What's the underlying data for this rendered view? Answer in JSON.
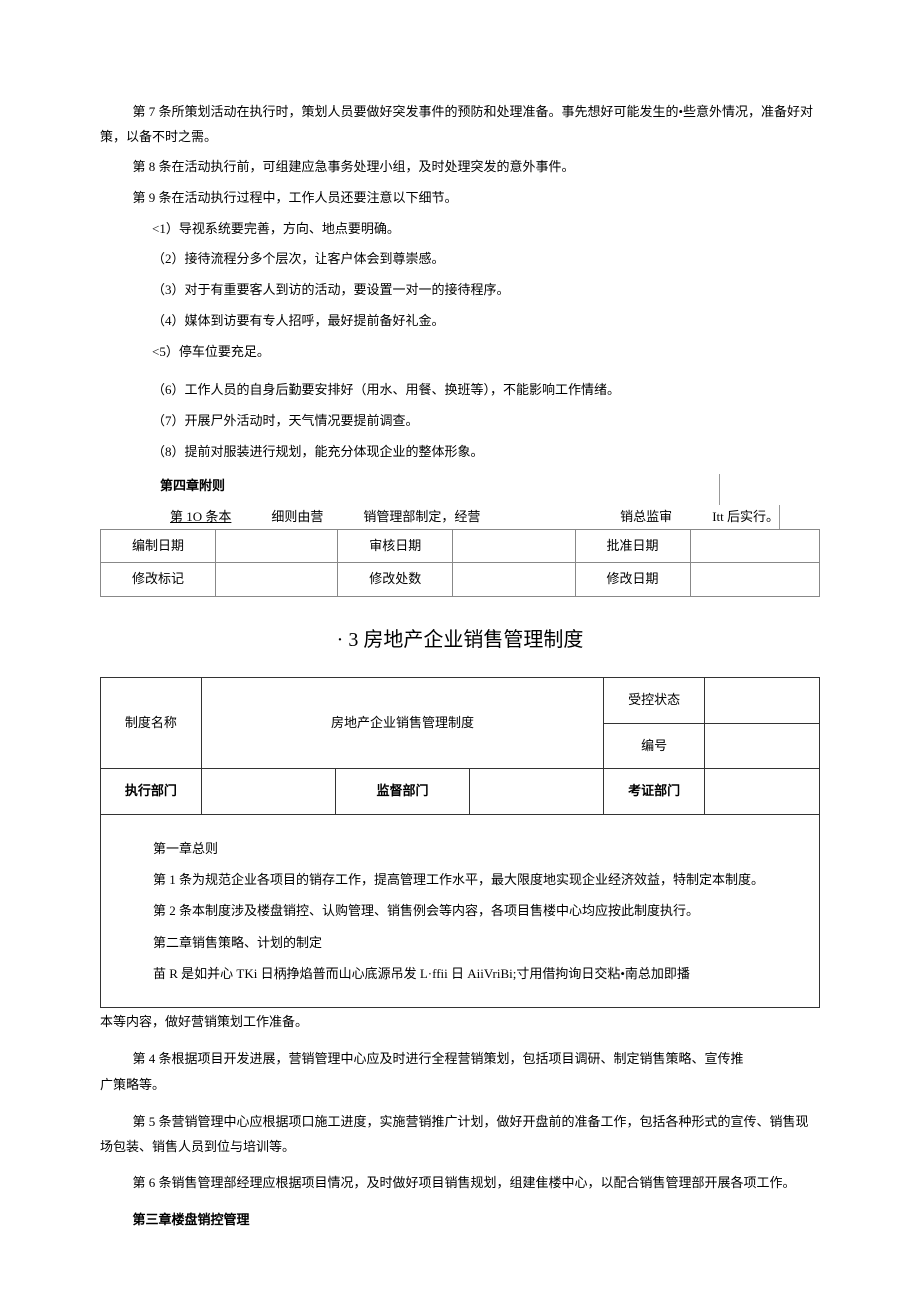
{
  "body": {
    "p7": "第 7 条所策划活动在执行时，策划人员要做好突发事件的预防和处理准备。事先想好可能发生的•些意外情况，准备好对策，以备不时之需。",
    "p8": "第 8 条在活动执行前，可组建应急事务处理小组，及时处理突发的意外事件。",
    "p9": "第 9 条在活动执行过程中，工作人员还要注意以下细节。",
    "s1": "<1）导视系统要完善，方向、地点要明确。",
    "s2": "（2）接待流程分多个层次，让客户体会到尊崇感。",
    "s3": "（3）对于有重要客人到访的活动，要设置一对一的接待程序。",
    "s4": "（4）媒体到访要有专人招呼，最好提前备好礼金。",
    "s5": "<5）停车位要充足。",
    "s6": "（6）工作人员的自身后勤要安排好（用水、用餐、换班等），不能影响工作情绪。",
    "s7": "（7）开展尸外活动时，天气情况要提前调查。",
    "s8": "（8）提前对服装进行规划，能充分体现企业的整体形象。",
    "chapter4": "第四章附则",
    "a10": {
      "a": "第 1O 条本",
      "b": "细则由营",
      "c": "销管理部制定，经营",
      "d": "销总监审",
      "e": "Itt 后实行。"
    }
  },
  "meta1": {
    "r1": {
      "c1": "编制日期",
      "c2": "",
      "c3": "审核日期",
      "c4": "",
      "c5": "批准日期",
      "c6": ""
    },
    "r2": {
      "c1": "修改标记",
      "c2": "",
      "c3": "修改处数",
      "c4": "",
      "c5": "修改日期",
      "c6": ""
    }
  },
  "section_title": "· 3 房地产企业销售管理制度",
  "dochead": {
    "name_label": "制度名称",
    "name_value": "房地产企业销售管理制度",
    "status_label": "受控状态",
    "status_value": "",
    "code_label": "编号",
    "code_value": "",
    "exec_label": "执行部门",
    "exec_value": "",
    "super_label": "监督部门",
    "super_value": "",
    "verify_label": "考证部门",
    "verify_value": ""
  },
  "box": {
    "ch1": "第一章总则",
    "p1": "第 1 条为规范企业各项目的销存工作，提高管理工作水平，最大限度地实现企业经济效益，特制定本制度。",
    "p2": "第 2 条本制度涉及楼盘销控、认购管理、销售例会等内容，各项目售楼中心均应按此制度执行。",
    "ch2": "第二章销售策略、计划的制定",
    "p3": "苗 R 是如并心 TKi 日柄挣焰普而山心底源吊发 L·ffii 日 AiiVriBi;寸用借拘询日交粘•南总加即播"
  },
  "after": {
    "pa": "本等内容，做好营销策划工作准备。",
    "pb": "第 4 条根据项目开发进展，营销管理中心应及时进行全程营销策划，包括项目调研、制定销售策略、宣传推",
    "pc": "广策略等。",
    "pd": "第 5 条营销管理中心应根据项口施工进度，实施营销推广计划，做好开盘前的准备工作，包括各种形式的宣传、销售现场包装、销售人员到位与培训等。",
    "pe": "第 6 条销售管理部经理应根据项目情况，及时做好项目销售规划，组建隹楼中心，以配合销售管理部开展各项工作。",
    "ch3": "第三章楼盘销控管理"
  }
}
